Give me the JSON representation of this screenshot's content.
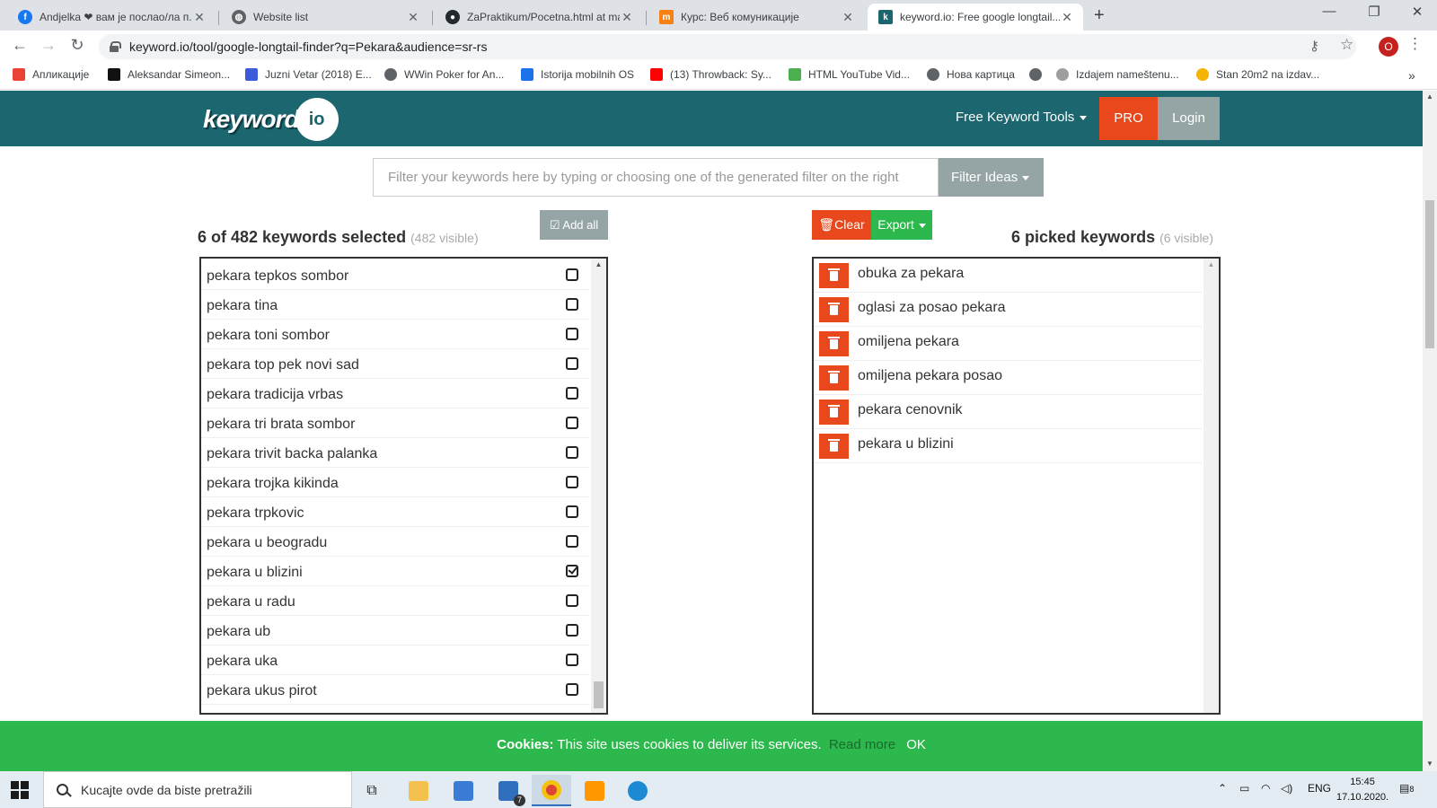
{
  "browser": {
    "tabs": [
      {
        "label": "Andjelka ❤ вам је послао/ла п...",
        "icon": "facebook-icon",
        "color": "#1877f2"
      },
      {
        "label": "Website list",
        "icon": "globe-icon",
        "color": "#5f6368"
      },
      {
        "label": "ZaPraktikum/Pocetna.html at ma...",
        "icon": "github-icon",
        "color": "#24292e"
      },
      {
        "label": "Курс: Веб комуникације",
        "icon": "moodle-icon",
        "color": "#f98012"
      },
      {
        "label": "keyword.io: Free google longtail...",
        "icon": "keyword-io-icon",
        "color": "#1c6670"
      }
    ],
    "url": "keyword.io/tool/google-longtail-finder?q=Pekara&audience=sr-rs",
    "profile_initial": "O",
    "bookmarks": [
      {
        "label": "Апликације",
        "color": "#ea4335"
      },
      {
        "label": "Aleksandar Simeon...",
        "color": "#111111"
      },
      {
        "label": "Juzni Vetar (2018) E...",
        "color": "#3b5bdb"
      },
      {
        "label": "WWin Poker for An...",
        "color": "#5f6368"
      },
      {
        "label": "Istorija mobilnih OS",
        "color": "#1a73e8"
      },
      {
        "label": "(13) Throwback: Sy...",
        "color": "#ff0000"
      },
      {
        "label": "HTML YouTube Vid...",
        "color": "#4caf50"
      },
      {
        "label": "Нова картица",
        "color": "#5f6368"
      },
      {
        "label": "",
        "color": "#5f6368"
      },
      {
        "label": "Izdajem nameštenu...",
        "color": "#9e9e9e"
      },
      {
        "label": "Stan 20m2 na izdav...",
        "color": "#f4b400"
      }
    ]
  },
  "site": {
    "logo_word": "keyword",
    "logo_suffix": "io",
    "nav_tools": "Free Keyword Tools",
    "nav_pro": "PRO",
    "nav_login": "Login",
    "filter_placeholder": "Filter your keywords here by typing or choosing one of the generated filter on the right",
    "filter_button": "Filter Ideas",
    "colors": {
      "teal": "#1c6670",
      "orange": "#e8481c",
      "green": "#2db84d",
      "gray": "#95a5a6"
    }
  },
  "left": {
    "title": "6 of 482 keywords selected",
    "visible": "(482 visible)",
    "add_all": "Add all",
    "keywords": [
      {
        "text": "pekara tepkos sombor",
        "checked": false
      },
      {
        "text": "pekara tina",
        "checked": false
      },
      {
        "text": "pekara toni sombor",
        "checked": false
      },
      {
        "text": "pekara top pek novi sad",
        "checked": false
      },
      {
        "text": "pekara tradicija vrbas",
        "checked": false
      },
      {
        "text": "pekara tri brata sombor",
        "checked": false
      },
      {
        "text": "pekara trivit backa palanka",
        "checked": false
      },
      {
        "text": "pekara trojka kikinda",
        "checked": false
      },
      {
        "text": "pekara trpkovic",
        "checked": false
      },
      {
        "text": "pekara u beogradu",
        "checked": false
      },
      {
        "text": "pekara u blizini",
        "checked": true
      },
      {
        "text": "pekara u radu",
        "checked": false
      },
      {
        "text": "pekara ub",
        "checked": false
      },
      {
        "text": "pekara uka",
        "checked": false
      },
      {
        "text": "pekara ukus pirot",
        "checked": false
      }
    ]
  },
  "right": {
    "title": "6 picked keywords",
    "visible": "(6 visible)",
    "clear": "Clear",
    "export": "Export",
    "keywords": [
      "obuka za pekara",
      "oglasi za posao pekara",
      "omiljena pekara",
      "omiljena pekara posao",
      "pekara cenovnik",
      "pekara u blizini"
    ]
  },
  "cookie": {
    "label": "Cookies:",
    "text": "This site uses cookies to deliver its services.",
    "read_more": "Read more",
    "ok": "OK"
  },
  "taskbar": {
    "search_placeholder": "Kucajte ovde da biste pretražili",
    "mail_badge": "7",
    "language": "ENG",
    "time": "15:45",
    "date": "17.10.2020.",
    "notifications": "8"
  }
}
